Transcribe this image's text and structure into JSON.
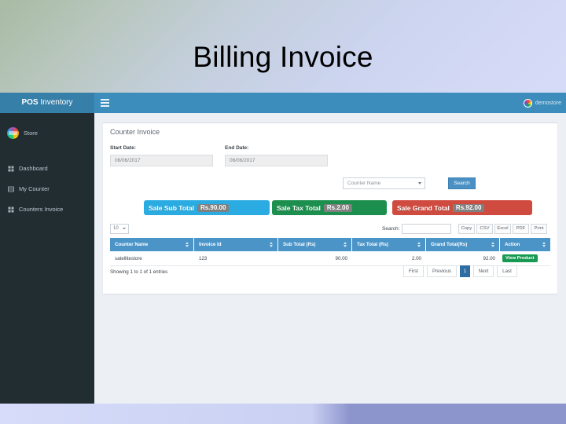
{
  "slide": {
    "title": "Billing Invoice"
  },
  "app": {
    "topbar": {
      "brand_bold": "POS",
      "brand_light": " Inventory",
      "menu_icon": "hamburger-icon",
      "user_name": "demostore",
      "user_avatar_icon": "avatar-icon"
    },
    "sidebar": {
      "store_name": "Store",
      "store_avatar_icon": "store-avatar-icon",
      "items": [
        {
          "label": "Dashboard",
          "icon": "dashboard-icon"
        },
        {
          "label": "My Counter",
          "icon": "counter-icon"
        },
        {
          "label": "Counters Invoice",
          "icon": "invoice-icon"
        }
      ]
    },
    "panel": {
      "title": "Counter Invoice",
      "start_date_label": "Start Date:",
      "start_date_value": "06/06/2017",
      "end_date_label": "End Date:",
      "end_date_value": "06/06/2017",
      "counter_select_value": "Counter Name",
      "search_button": "Search"
    },
    "totals": [
      {
        "label": "Sale Sub Total",
        "value": "Rs.90.00",
        "color": "#2aace2"
      },
      {
        "label": "Sale Tax Total",
        "value": "Rs.2.00",
        "color": "#1c8f4e"
      },
      {
        "label": "Sale Grand Total",
        "value": "Rs.92.00",
        "color": "#cf4b3f"
      }
    ],
    "table_controls": {
      "length_value": "10",
      "search_label": "Search:",
      "search_value": "",
      "search_placeholder": "",
      "export_buttons": [
        "Copy",
        "CSV",
        "Excel",
        "PDF",
        "Print"
      ]
    },
    "table": {
      "headers": [
        "Counter Name",
        "Invoice Id",
        "Sub Total (Rs)",
        "Tax Total (Rs)",
        "Grand Total(Rs)",
        "Action"
      ],
      "rows": [
        {
          "counter_name": "satellitestore",
          "invoice_id": "123",
          "sub_total": "90.00",
          "tax_total": "2.00",
          "grand_total": "92.00",
          "action_label": "View Product"
        }
      ],
      "info": "Showing 1 to 1 of 1 entries"
    },
    "pagination": {
      "first": "First",
      "previous": "Previous",
      "current_page": "1",
      "next": "Next",
      "last": "Last"
    }
  }
}
